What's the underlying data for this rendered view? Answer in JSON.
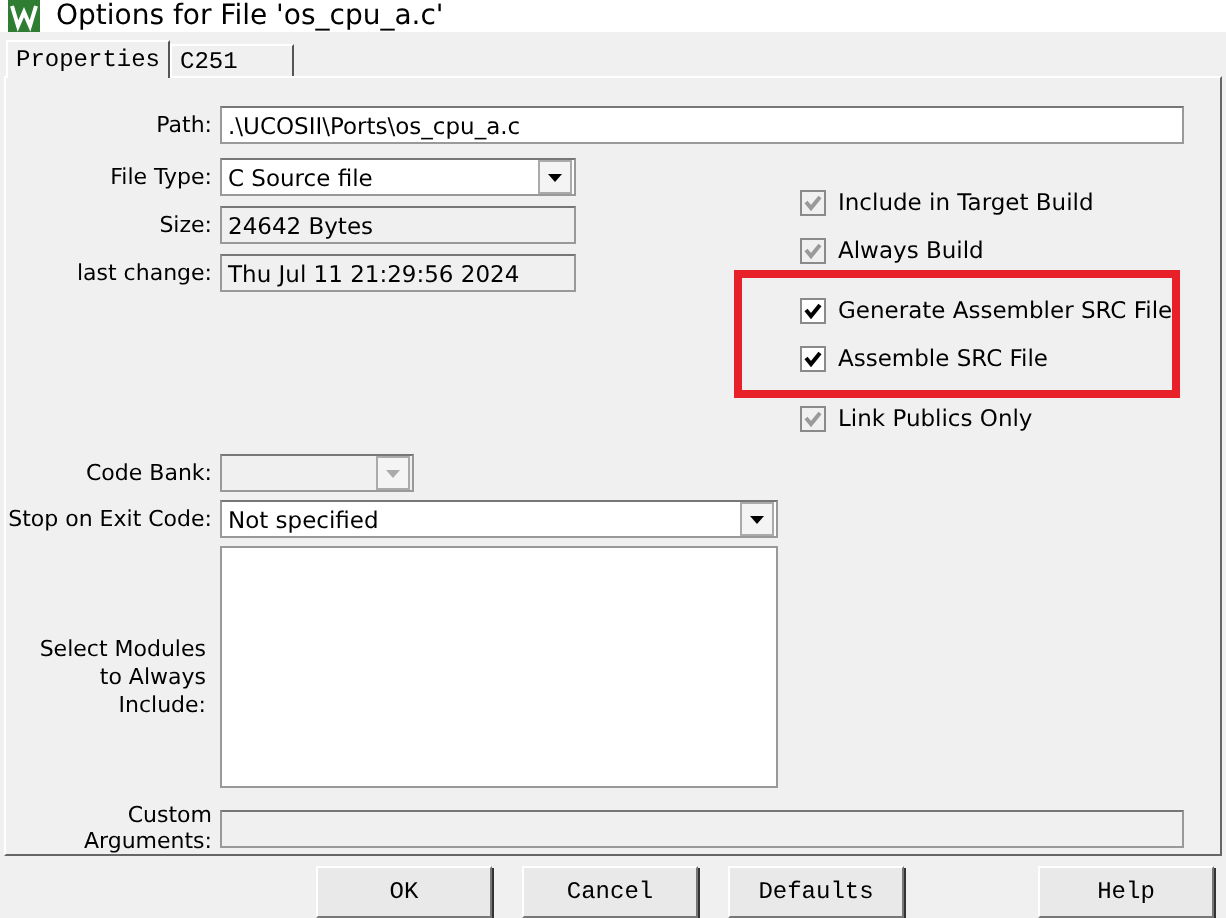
{
  "window": {
    "title": "Options for File 'os_cpu_a.c'"
  },
  "tabs": [
    {
      "label": "Properties",
      "selected": true
    },
    {
      "label": "C251",
      "selected": false
    }
  ],
  "path": {
    "label": "Path:",
    "value": ".\\UCOSII\\Ports\\os_cpu_a.c"
  },
  "file_type": {
    "label": "File Type:",
    "value": "C Source file"
  },
  "size": {
    "label": "Size:",
    "value": "24642 Bytes"
  },
  "last_change": {
    "label": "last change:",
    "value": "Thu Jul 11 21:29:56 2024"
  },
  "options": [
    {
      "label": "Include in Target Build",
      "checked": true,
      "disabled": true,
      "highlighted": false
    },
    {
      "label": "Always Build",
      "checked": true,
      "disabled": true,
      "highlighted": false
    },
    {
      "label": "Generate Assembler SRC File",
      "checked": true,
      "disabled": false,
      "highlighted": true
    },
    {
      "label": "Assemble SRC File",
      "checked": true,
      "disabled": false,
      "highlighted": true
    },
    {
      "label": "Link Publics Only",
      "checked": true,
      "disabled": true,
      "highlighted": false
    }
  ],
  "code_bank": {
    "label": "Code Bank:",
    "disabled": true
  },
  "stop_on_exit": {
    "label": "Stop on Exit Code:",
    "value": "Not specified"
  },
  "modules": {
    "label": "Select Modules to Always Include:"
  },
  "custom_arguments": {
    "label": "Custom Arguments:",
    "disabled": true
  },
  "buttons": [
    "OK",
    "Cancel",
    "Defaults",
    "Help"
  ]
}
